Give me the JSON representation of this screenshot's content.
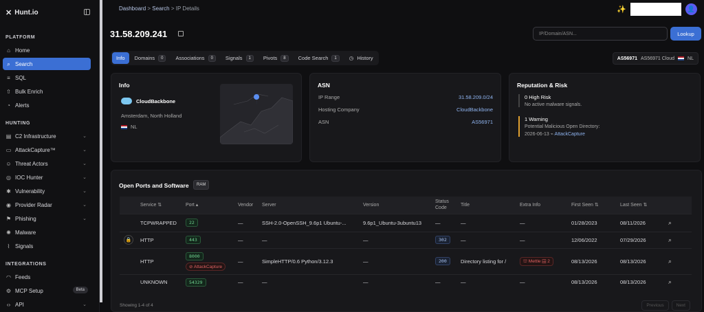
{
  "app": {
    "name": "Hunt.io"
  },
  "sidebar": {
    "sections": {
      "platform": "PLATFORM",
      "hunting": "HUNTING",
      "integrations": "INTEGRATIONS"
    },
    "platform": [
      {
        "label": "Home",
        "icon": "home-icon"
      },
      {
        "label": "Search",
        "icon": "search-icon",
        "active": true
      },
      {
        "label": "SQL",
        "icon": "database-icon"
      },
      {
        "label": "Bulk Enrich",
        "icon": "upload-icon"
      },
      {
        "label": "Alerts",
        "icon": "bell-icon"
      }
    ],
    "hunting": [
      {
        "label": "C2 Infrastructure"
      },
      {
        "label": "AttackCapture™"
      },
      {
        "label": "Threat Actors"
      },
      {
        "label": "IOC Hunter"
      },
      {
        "label": "Vulnerability"
      },
      {
        "label": "Provider Radar"
      },
      {
        "label": "Phishing"
      },
      {
        "label": "Malware"
      },
      {
        "label": "Signals"
      }
    ],
    "integrations": [
      {
        "label": "Feeds"
      },
      {
        "label": "MCP Setup",
        "badge": "Beta"
      },
      {
        "label": "API"
      }
    ]
  },
  "breadcrumb": {
    "home": "Dashboard",
    "sep": ">",
    "search": "Search",
    "current": "IP Details"
  },
  "header": {
    "ip": "31.58.209.241",
    "search_placeholder": "IP/Domain/ASN...",
    "lookup": "Lookup",
    "avatar": "👤"
  },
  "tabs": [
    {
      "label": "Info",
      "active": true
    },
    {
      "label": "Domains",
      "count": "0"
    },
    {
      "label": "Associations",
      "count": "0"
    },
    {
      "label": "Signals",
      "count": "1"
    },
    {
      "label": "Pivots",
      "count": "8"
    },
    {
      "label": "Code Search",
      "count": "1"
    },
    {
      "label": "History"
    }
  ],
  "asn_pill": {
    "asn": "AS56971",
    "name": "AS56971 Cloud",
    "cc": "NL"
  },
  "info": {
    "title": "Info",
    "provider": "CloudBackbone",
    "location": "Amsterdam, North Holland",
    "cc": "NL"
  },
  "asn": {
    "title": "ASN",
    "rows": [
      {
        "k": "IP Range",
        "v": "31.58.209.0/24"
      },
      {
        "k": "Hosting Company",
        "v": "CloudBackbone"
      },
      {
        "k": "ASN",
        "v": "AS56971"
      }
    ]
  },
  "risk": {
    "title": "Reputation & Risk",
    "items": [
      {
        "t": "0 High Risk",
        "s": "No active malware signals."
      },
      {
        "t": "1 Warning",
        "s": "Potential Malicious Open Directory:",
        "date": "2026-06-13",
        "src": "AttackCapture"
      }
    ]
  },
  "ports": {
    "title": "Open Ports and Software",
    "ram": "RAM",
    "headers": [
      "Service",
      "Port",
      "Vendor",
      "Server",
      "Version",
      "Status Code",
      "Title",
      "Extra Info",
      "First Seen",
      "Last Seen"
    ],
    "rows": [
      {
        "service": "TCPWRAPPED",
        "port": "22",
        "vendor": "—",
        "server": "SSH-2.0-OpenSSH_9.6p1 Ubuntu-...",
        "version": "9.6p1_Ubuntu-3ubuntu13",
        "status": "—",
        "title": "—",
        "extra": "—",
        "first": "01/28/2023",
        "last": "08/11/2026"
      },
      {
        "service": "HTTP",
        "port": "443",
        "vendor": "—",
        "server": "—",
        "version": "—",
        "status": "302",
        "title": "—",
        "extra": "—",
        "first": "12/06/2022",
        "last": "07/29/2026",
        "lock": true
      },
      {
        "service": "HTTP",
        "port": "8000",
        "tag": "AttackCapture",
        "vendor": "—",
        "server": "SimpleHTTP/0.6 Python/3.12.3",
        "version": "—",
        "status": "200",
        "title": "Directory listing for /",
        "extra_a": "Mettle",
        "extra_b": "2",
        "first": "08/13/2026",
        "last": "08/13/2026"
      },
      {
        "service": "UNKNOWN",
        "port": "54329",
        "vendor": "—",
        "server": "—",
        "version": "—",
        "status": "—",
        "title": "—",
        "extra": "—",
        "first": "08/13/2026",
        "last": "08/13/2026"
      }
    ],
    "showing": "Showing 1-4 of 4",
    "prev": "Previous",
    "next": "Next"
  },
  "colors": {
    "accent": "#3b6fd4",
    "link": "#8fb4f0",
    "warning": "#e0a030",
    "danger": "#e06060",
    "success": "#6fd28f"
  }
}
